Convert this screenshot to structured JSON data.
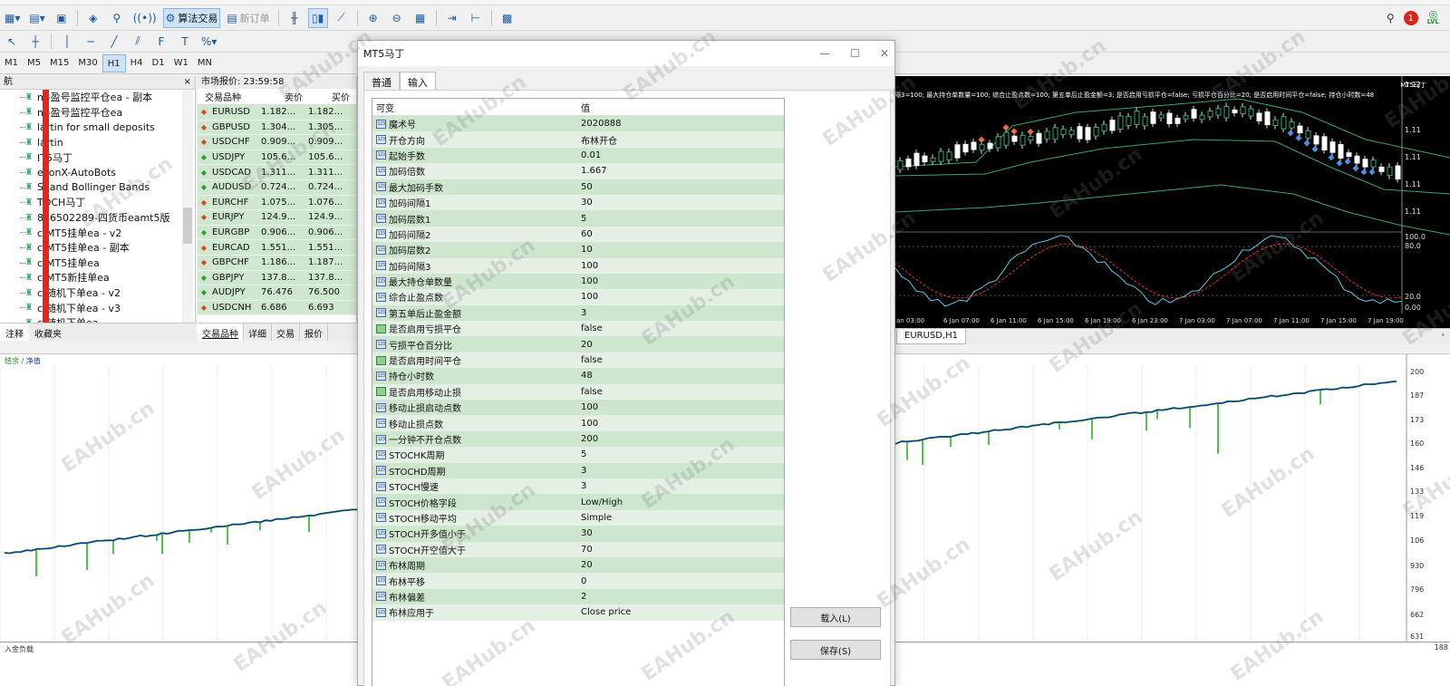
{
  "toolbar": {
    "algo_trading_label": "算法交易",
    "new_order_label": "新订单",
    "timeframes": [
      "M1",
      "M5",
      "M15",
      "M30",
      "H1",
      "H4",
      "D1",
      "W1",
      "MN"
    ],
    "active_timeframe": "H1",
    "notification_count": "1",
    "level_label": "LVL"
  },
  "navigator": {
    "title": "航",
    "items": [
      "m-盈号监控平仓ea - 副本",
      "m-盈号监控平仓ea",
      "lartin for small deposits",
      "lartin",
      "IT5马丁",
      "ekonX-AutoBots",
      "SI and Bollinger Bands",
      "TOCH马丁",
      "846502289-四货币eamt5版",
      "c-MT5挂单ea - v2",
      "c-MT5挂单ea - 副本",
      "c-MT5挂单ea",
      "c-MT5新挂单ea",
      "c-随机下单ea - v2",
      "c-随机下单ea - v3",
      "c-随机下单ea"
    ],
    "tabs": [
      "注释",
      "收藏夹"
    ]
  },
  "market_watch": {
    "title": "市场报价: 23:59:58",
    "col_symbol": "交易品种",
    "col_bid": "卖价",
    "col_ask": "买价",
    "rows": [
      {
        "symbol": "EURUSD",
        "bid": "1.182...",
        "ask": "1.182...",
        "dir": "dn"
      },
      {
        "symbol": "GBPUSD",
        "bid": "1.304...",
        "ask": "1.305...",
        "dir": "dn"
      },
      {
        "symbol": "USDCHF",
        "bid": "0.909...",
        "ask": "0.909...",
        "dir": "dn"
      },
      {
        "symbol": "USDJPY",
        "bid": "105.6...",
        "ask": "105.6...",
        "dir": "up"
      },
      {
        "symbol": "USDCAD",
        "bid": "1.311...",
        "ask": "1.311...",
        "dir": "up"
      },
      {
        "symbol": "AUDUSD",
        "bid": "0.724...",
        "ask": "0.724...",
        "dir": "up"
      },
      {
        "symbol": "EURCHF",
        "bid": "1.075...",
        "ask": "1.076...",
        "dir": "dn"
      },
      {
        "symbol": "EURJPY",
        "bid": "124.9...",
        "ask": "124.9...",
        "dir": "dn"
      },
      {
        "symbol": "EURGBP",
        "bid": "0.906...",
        "ask": "0.906...",
        "dir": "up"
      },
      {
        "symbol": "EURCAD",
        "bid": "1.551...",
        "ask": "1.551...",
        "dir": "dn"
      },
      {
        "symbol": "GBPCHF",
        "bid": "1.186...",
        "ask": "1.187...",
        "dir": "dn"
      },
      {
        "symbol": "GBPJPY",
        "bid": "137.8...",
        "ask": "137.8...",
        "dir": "up"
      },
      {
        "symbol": "AUDJPY",
        "bid": "76.476",
        "ask": "76.500",
        "dir": "up"
      },
      {
        "symbol": "USDCNH",
        "bid": "6.686",
        "ask": "6.693",
        "dir": "dn"
      }
    ],
    "tabs": [
      "交易品种",
      "详细",
      "交易",
      "报价"
    ]
  },
  "dialog": {
    "title": "MT5马丁",
    "tabs": [
      "普通",
      "输入"
    ],
    "active_tab": "输入",
    "col_variable": "可变",
    "col_value": "值",
    "params": [
      {
        "type": "123",
        "name": "魔术号",
        "value": "2020888"
      },
      {
        "type": "123",
        "name": "开仓方向",
        "value": "布林开仓"
      },
      {
        "type": "123",
        "name": "起始手数",
        "value": "0.01"
      },
      {
        "type": "123",
        "name": "加码倍数",
        "value": "1.667"
      },
      {
        "type": "123",
        "name": "最大加码手数",
        "value": "50"
      },
      {
        "type": "123",
        "name": "加码间隔1",
        "value": "30"
      },
      {
        "type": "123",
        "name": "加码层数1",
        "value": "5"
      },
      {
        "type": "123",
        "name": "加码间隔2",
        "value": "60"
      },
      {
        "type": "123",
        "name": "加码层数2",
        "value": "10"
      },
      {
        "type": "123",
        "name": "加码间隔3",
        "value": "100"
      },
      {
        "type": "123",
        "name": "最大持仓单数量",
        "value": "100"
      },
      {
        "type": "123",
        "name": "综合止盈点数",
        "value": "100"
      },
      {
        "type": "123",
        "name": "第五单后止盈金额",
        "value": "3"
      },
      {
        "type": "bool",
        "name": "是否启用亏损平仓",
        "value": "false"
      },
      {
        "type": "123",
        "name": "亏损平仓百分比",
        "value": "20"
      },
      {
        "type": "bool",
        "name": "是否启用时间平仓",
        "value": "false"
      },
      {
        "type": "123",
        "name": "持仓小时数",
        "value": "48"
      },
      {
        "type": "bool",
        "name": "是否启用移动止损",
        "value": "false"
      },
      {
        "type": "123",
        "name": "移动止损启动点数",
        "value": "100"
      },
      {
        "type": "123",
        "name": "移动止损点数",
        "value": "100"
      },
      {
        "type": "123",
        "name": "一分钟不开仓点数",
        "value": "200"
      },
      {
        "type": "123",
        "name": "STOCHK周期",
        "value": "5"
      },
      {
        "type": "123",
        "name": "STOCHD周期",
        "value": "3"
      },
      {
        "type": "123",
        "name": "STOCH慢速",
        "value": "3"
      },
      {
        "type": "123",
        "name": "STOCH价格字段",
        "value": "Low/High"
      },
      {
        "type": "123",
        "name": "STOCH移动平均",
        "value": "Simple"
      },
      {
        "type": "123",
        "name": "STOCH开多值小于",
        "value": "30"
      },
      {
        "type": "123",
        "name": "STOCH开空值大于",
        "value": "70"
      },
      {
        "type": "123",
        "name": "布林周期",
        "value": "20"
      },
      {
        "type": "123",
        "name": "布林平移",
        "value": "0"
      },
      {
        "type": "123",
        "name": "布林偏差",
        "value": "2"
      },
      {
        "type": "123",
        "name": "布林应用于",
        "value": "Close price"
      }
    ],
    "load_button": "载入(L)",
    "save_button": "保存(S)"
  },
  "chart": {
    "ea_label": "MT5马丁",
    "info_text": "隔3=100; 最大持仓单数量=100; 综合止盈点数=100; 第五单后止盈金额=3; 是否启用亏损平仓=false; 亏损平仓百分比=20; 是否启用时间平仓=false; 持仓小时数=48",
    "time_labels": [
      "an 03:00",
      "6 Jan 07:00",
      "6 Jan 11:00",
      "6 Jan 15:00",
      "6 Jan 19:00",
      "6 Jan 23:00",
      "7 Jan 03:00",
      "7 Jan 07:00",
      "7 Jan 11:00",
      "7 Jan 15:00",
      "7 Jan 19:00"
    ],
    "price_labels": [
      "1.12",
      "1.11",
      "1.11",
      "1.11",
      "1.11"
    ],
    "osc_labels": [
      "100.0",
      "80.0",
      "20.0",
      "0.00"
    ],
    "tab_label": "EURUSD,H1"
  },
  "graph": {
    "title_balance": "结余",
    "title_equity": "净值",
    "y_labels": [
      "200",
      "187",
      "173",
      "160",
      "146",
      "133",
      "119",
      "106",
      "930",
      "796",
      "662",
      "631"
    ],
    "sub_title": "入金负载",
    "sub_y_label": "188"
  },
  "watermark": "EAHub.cn",
  "colors": {
    "accent": "#1c5aa6",
    "equity_green": "#16b316",
    "balance_blue": "#1a2fa0",
    "grid_green": "#cde6cd",
    "chart_bg": "#000000"
  }
}
